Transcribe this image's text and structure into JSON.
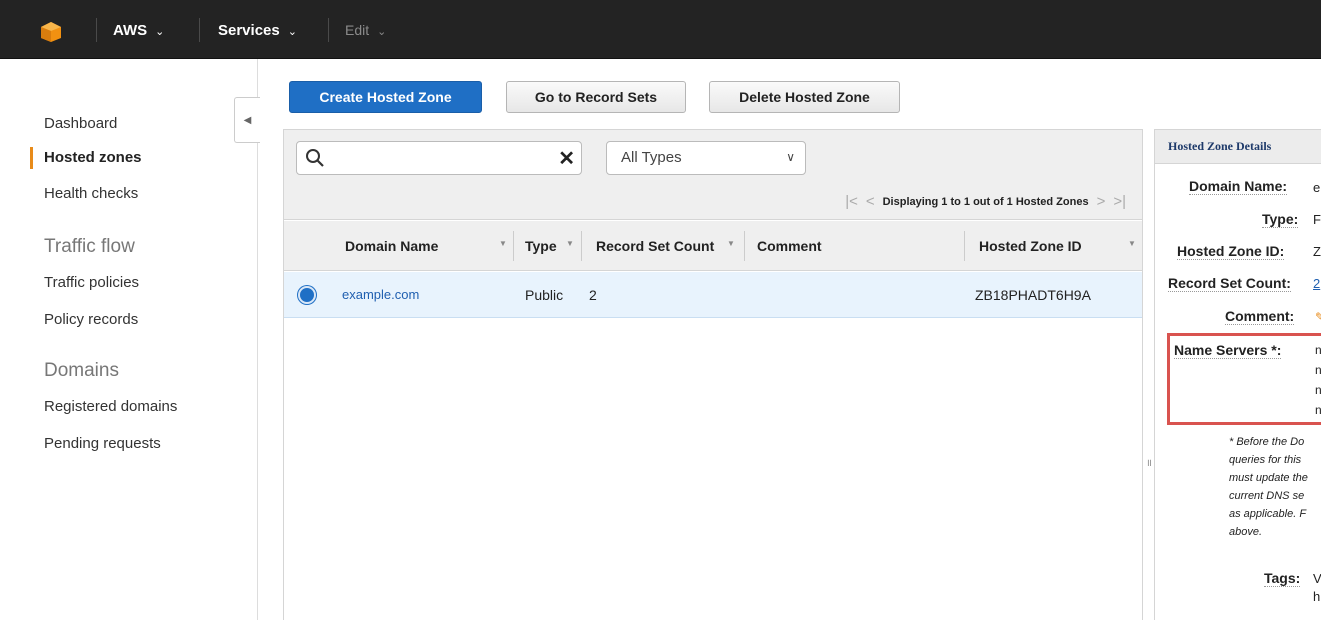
{
  "topnav": {
    "logo_icon": "aws-cube-icon",
    "aws_label": "AWS",
    "services_label": "Services",
    "edit_label": "Edit",
    "chevron": "⌄"
  },
  "sidebar": {
    "items": [
      {
        "label": "Dashboard"
      },
      {
        "label": "Hosted zones",
        "active": true
      },
      {
        "label": "Health checks"
      },
      {
        "label": "Traffic policies"
      },
      {
        "label": "Policy records"
      },
      {
        "label": "Registered domains"
      },
      {
        "label": "Pending requests"
      }
    ],
    "sections": [
      "Traffic flow",
      "Domains"
    ],
    "accent_color": "#e88b1a"
  },
  "actions": {
    "create": "Create Hosted Zone",
    "goto": "Go to Record Sets",
    "delete": "Delete Hosted Zone"
  },
  "filter": {
    "search_value": "",
    "type_selected": "All Types"
  },
  "pager": {
    "text": "Displaying 1 to 1 out of 1 Hosted Zones"
  },
  "table": {
    "columns": [
      "Domain Name",
      "Type",
      "Record Set Count",
      "Comment",
      "Hosted Zone ID"
    ],
    "rows": [
      {
        "domain": "example.com",
        "type": "Public",
        "count": "2",
        "comment": "",
        "zone_id": "ZB18PHADT6H9A",
        "selected": true
      }
    ]
  },
  "detail": {
    "header": "Hosted Zone Details",
    "labels": {
      "domain": "Domain Name:",
      "type": "Type:",
      "zone_id": "Hosted Zone ID:",
      "count": "Record Set Count:",
      "comment": "Comment:",
      "ns": "Name Servers *:",
      "tags": "Tags:"
    },
    "values": {
      "domain": "e",
      "type": "F",
      "zone_id": "Z",
      "count": "2",
      "comment": "",
      "ns": [
        "n",
        "n",
        "n",
        "n"
      ],
      "tags": [
        "V",
        "h"
      ]
    },
    "note_lines": [
      "* Before the Do",
      "queries for this",
      "must update the",
      "current DNS se",
      "as applicable. F",
      "above."
    ],
    "highlight_color": "#d9534f"
  }
}
